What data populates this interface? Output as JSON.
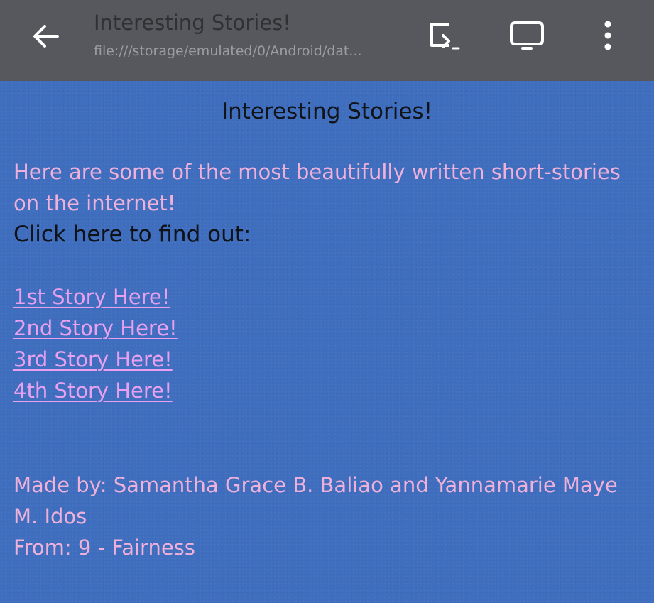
{
  "browser": {
    "title": "Interesting Stories!",
    "url": "file:///storage/emulated/0/Android/dat..."
  },
  "toolbar_icons": [
    "back-arrow-icon",
    "cast-icon",
    "desktop-icon",
    "more-vert-icon"
  ],
  "page": {
    "heading": "Interesting Stories!",
    "intro": "Here are some of the most beautifully written short-stories on the internet!",
    "click_prompt": "Click here to find out:",
    "links": [
      "1st Story Here!",
      "2nd Story Here!",
      "3rd Story Here!",
      "4th Story Here!"
    ],
    "credits": {
      "made_by": "Made by: Samantha Grace B. Baliao and Yannamarie Maye M. Idos",
      "from": "From: 9 - Fairness"
    }
  },
  "colors": {
    "toolbar_bg": "#56585d",
    "page_bg": "#3f6ebe",
    "pink_text": "#efb1da",
    "link_text": "#e9a0f0",
    "dark_text": "#111418"
  }
}
